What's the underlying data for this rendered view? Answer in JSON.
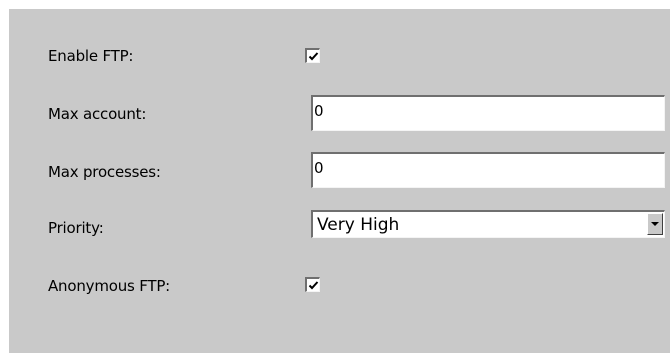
{
  "form": {
    "enable_ftp": {
      "label": "Enable FTP:",
      "checked": true
    },
    "max_account": {
      "label": "Max account:",
      "value": "0"
    },
    "max_processes": {
      "label": "Max processes:",
      "value": "0"
    },
    "priority": {
      "label": "Priority:",
      "selected": "Very High"
    },
    "anonymous_ftp": {
      "label": "Anonymous FTP:",
      "checked": true
    }
  },
  "icons": {
    "checkmark": "checkmark-icon",
    "dropdown": "chevron-down-icon"
  },
  "colors": {
    "panel_bg": "#c9c9c9",
    "field_bg": "#ffffff",
    "border_dark": "#6f6f6f",
    "border_light": "#f4f4f4"
  }
}
